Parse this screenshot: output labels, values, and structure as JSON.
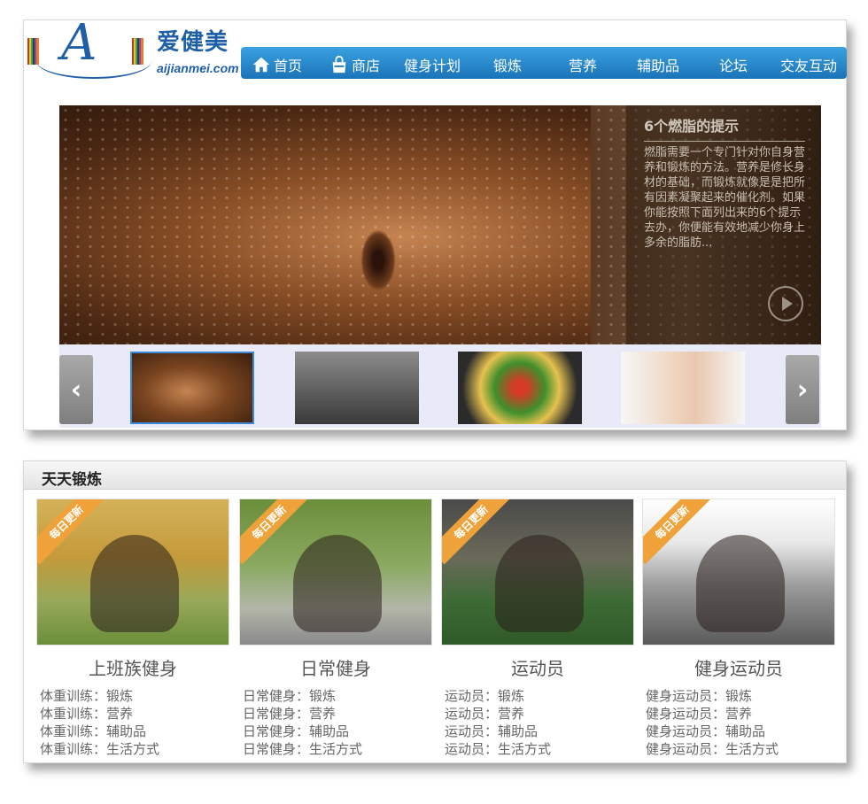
{
  "logo": {
    "cn": "爱健美",
    "en": "aijianmei.com"
  },
  "nav": [
    {
      "label": "首页",
      "icon": "home-icon"
    },
    {
      "label": "商店",
      "icon": "shopping-bag-icon"
    },
    {
      "label": "健身计划"
    },
    {
      "label": "锻炼"
    },
    {
      "label": "营养"
    },
    {
      "label": "辅助品"
    },
    {
      "label": "论坛"
    },
    {
      "label": "交友互动"
    }
  ],
  "banner": {
    "title": "6个燃脂的提示",
    "text": "燃脂需要一个专门针对你自身营养和锻炼的方法。营养是修长身材的基础，而锻炼就像是是把所有因素凝聚起来的催化剂。如果你能按照下面列出来的6个提示去办，你便能有效地减少你身上多余的脂肪..."
  },
  "section": {
    "title": "天天锻炼",
    "ribbon": "每日更新",
    "cards": [
      {
        "title": "上班族健身",
        "items": [
          "体重训练：锻炼",
          "体重训练：营养",
          "体重训练：辅助品",
          "体重训练：生活方式"
        ]
      },
      {
        "title": "日常健身",
        "items": [
          "日常健身：锻炼",
          "日常健身：营养",
          "日常健身：辅助品",
          "日常健身：生活方式"
        ]
      },
      {
        "title": "运动员",
        "items": [
          "运动员：锻炼",
          "运动员：营养",
          "运动员：辅助品",
          "运动员：生活方式"
        ]
      },
      {
        "title": "健身运动员",
        "items": [
          "健身运动员：锻炼",
          "健身运动员：营养",
          "健身运动员：辅助品",
          "健身运动员：生活方式"
        ]
      }
    ]
  }
}
